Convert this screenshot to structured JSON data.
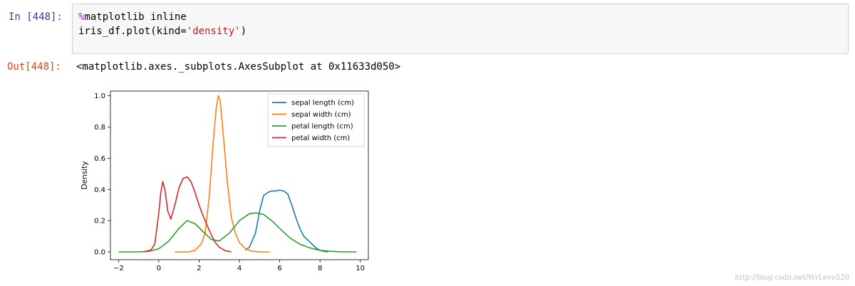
{
  "cell": {
    "in_prompt": "In [448]:",
    "code_magic": "%",
    "code_line1_rest": "matplotlib inline",
    "code_line2_a": "iris_df.plot(kind=",
    "code_line2_str": "'density'",
    "code_line2_b": ")",
    "out_prompt": "Out[448]:",
    "out_text": "<matplotlib.axes._subplots.AxesSubplot at 0x11633d050>"
  },
  "watermark": "http://blog.csdn.net/WrLevo520",
  "chart_data": {
    "type": "line",
    "ylabel": "Density",
    "xlabel": "",
    "xlim": [
      -2.4,
      10.4
    ],
    "ylim": [
      -0.05,
      1.03
    ],
    "xticks": [
      -2,
      0,
      2,
      4,
      6,
      8,
      10
    ],
    "yticks": [
      0.0,
      0.2,
      0.4,
      0.6,
      0.8,
      1.0
    ],
    "xtick_labels": [
      "−2",
      "0",
      "2",
      "4",
      "6",
      "8",
      "10"
    ],
    "ytick_labels": [
      "0.0",
      "0.2",
      "0.4",
      "0.6",
      "0.8",
      "1.0"
    ],
    "legend_position": "top-right",
    "grid": false,
    "series": [
      {
        "name": "sepal length (cm)",
        "color": "#1f77b4",
        "x": [
          4.3,
          4.5,
          4.8,
          5.0,
          5.2,
          5.4,
          5.6,
          5.8,
          6.0,
          6.2,
          6.4,
          6.6,
          6.8,
          7.0,
          7.2,
          7.4,
          7.6,
          7.8,
          8.0,
          8.2,
          8.4
        ],
        "y": [
          0.01,
          0.03,
          0.12,
          0.26,
          0.36,
          0.38,
          0.39,
          0.39,
          0.395,
          0.39,
          0.37,
          0.3,
          0.22,
          0.15,
          0.1,
          0.075,
          0.05,
          0.025,
          0.01,
          0.003,
          0.0
        ]
      },
      {
        "name": "sepal width (cm)",
        "color": "#ff7f0e",
        "x": [
          0.8,
          1.2,
          1.5,
          1.8,
          2.1,
          2.3,
          2.5,
          2.7,
          2.85,
          2.95,
          3.05,
          3.2,
          3.4,
          3.6,
          3.8,
          4.0,
          4.3,
          4.6,
          5.0,
          5.5
        ],
        "y": [
          0.0,
          0.0,
          0.0,
          0.01,
          0.05,
          0.12,
          0.35,
          0.7,
          0.92,
          1.0,
          0.97,
          0.75,
          0.45,
          0.22,
          0.12,
          0.06,
          0.02,
          0.005,
          0.0,
          0.0
        ]
      },
      {
        "name": "petal length (cm)",
        "color": "#2ca02c",
        "x": [
          -2.0,
          -1.0,
          -0.5,
          0.0,
          0.5,
          1.0,
          1.4,
          1.8,
          2.2,
          2.6,
          3.0,
          3.5,
          4.0,
          4.5,
          4.8,
          5.2,
          5.6,
          6.0,
          6.5,
          7.0,
          7.5,
          8.0,
          8.5,
          9.0,
          9.8
        ],
        "y": [
          0.0,
          0.0,
          0.003,
          0.02,
          0.07,
          0.15,
          0.2,
          0.18,
          0.13,
          0.08,
          0.07,
          0.12,
          0.2,
          0.245,
          0.25,
          0.24,
          0.2,
          0.15,
          0.09,
          0.05,
          0.025,
          0.01,
          0.004,
          0.001,
          0.0
        ]
      },
      {
        "name": "petal width (cm)",
        "color": "#d62728",
        "x": [
          -0.8,
          -0.4,
          -0.2,
          0.0,
          0.1,
          0.2,
          0.3,
          0.45,
          0.6,
          0.8,
          1.0,
          1.2,
          1.4,
          1.6,
          1.8,
          2.0,
          2.2,
          2.4,
          2.6,
          2.8,
          3.0,
          3.3,
          3.6
        ],
        "y": [
          0.0,
          0.01,
          0.05,
          0.25,
          0.38,
          0.45,
          0.4,
          0.26,
          0.21,
          0.3,
          0.41,
          0.47,
          0.48,
          0.45,
          0.38,
          0.3,
          0.23,
          0.17,
          0.11,
          0.06,
          0.03,
          0.008,
          0.0
        ]
      }
    ]
  }
}
